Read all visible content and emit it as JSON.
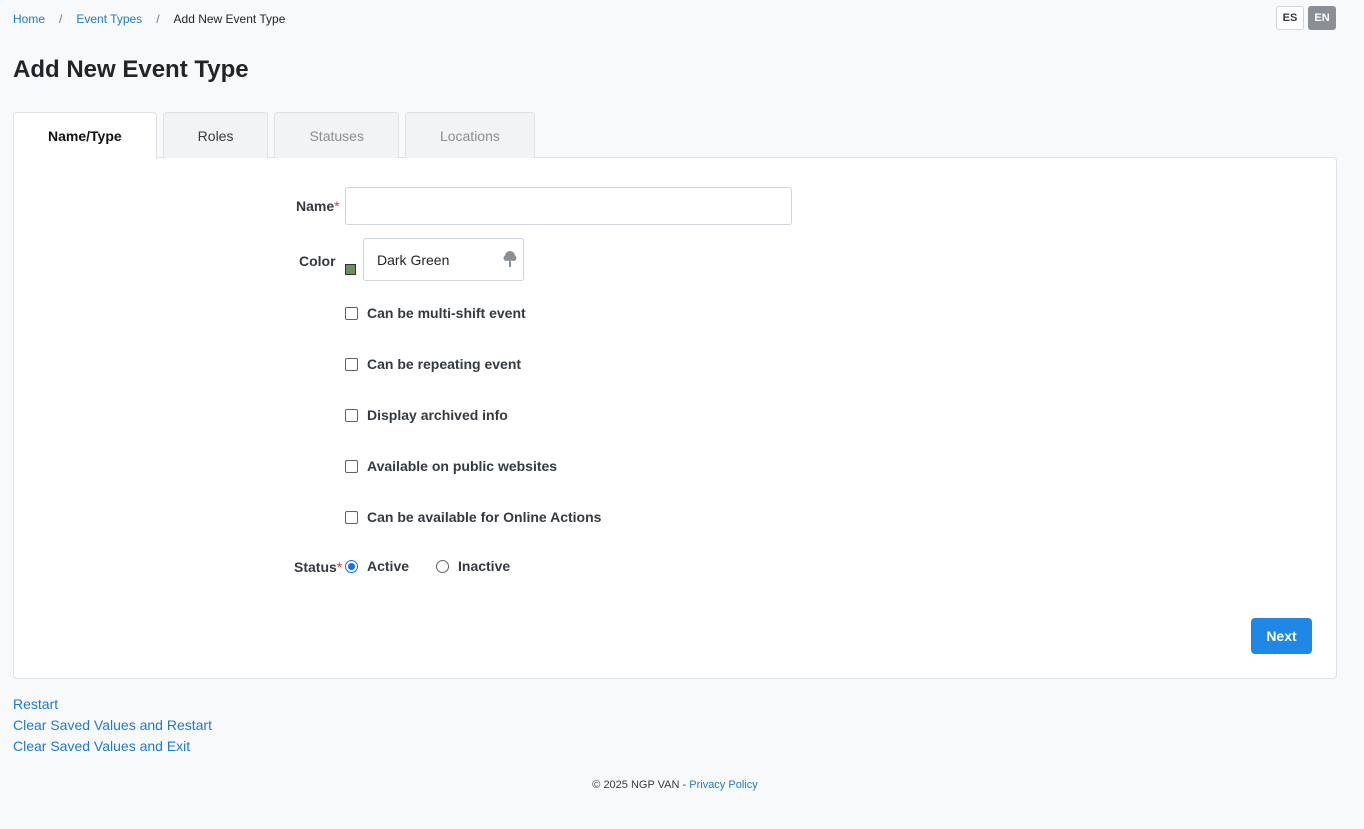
{
  "breadcrumb": {
    "home": "Home",
    "event_types": "Event Types",
    "current": "Add New Event Type",
    "separator": "/"
  },
  "lang": {
    "es": "ES",
    "en": "EN",
    "active": "EN"
  },
  "page": {
    "title": "Add New Event Type"
  },
  "tabs": [
    {
      "label": "Name/Type",
      "state": "active"
    },
    {
      "label": "Roles",
      "state": "enabled"
    },
    {
      "label": "Statuses",
      "state": "disabled"
    },
    {
      "label": "Locations",
      "state": "disabled"
    }
  ],
  "form": {
    "name_label": "Name",
    "name_value": "",
    "required_mark": "*",
    "color_label": "Color",
    "color_value": "Dark Green",
    "color_swatch": "#6b8f5e",
    "color_icon": "tree-icon",
    "checkboxes": [
      {
        "label": "Can be multi-shift event",
        "checked": false
      },
      {
        "label": "Can be repeating event",
        "checked": false
      },
      {
        "label": "Display archived info",
        "checked": false
      },
      {
        "label": "Available on public websites",
        "checked": false
      },
      {
        "label": "Can be available for Online Actions",
        "checked": false
      }
    ],
    "status_label": "Status",
    "status_options": [
      {
        "label": "Active",
        "selected": true
      },
      {
        "label": "Inactive",
        "selected": false
      }
    ],
    "next_label": "Next"
  },
  "links": {
    "restart": "Restart",
    "clear_restart": "Clear Saved Values and Restart",
    "clear_exit": "Clear Saved Values and Exit"
  },
  "footer": {
    "copyright": "© 2025 NGP VAN -",
    "privacy": "Privacy Policy"
  },
  "colors": {
    "accent": "#1f87e5",
    "link": "#1f7acb",
    "required": "#dc3545"
  }
}
